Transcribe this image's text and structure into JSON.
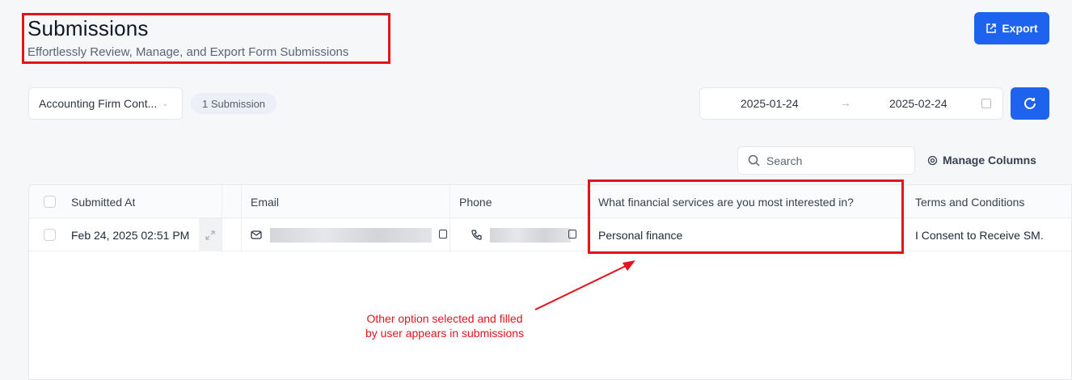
{
  "header": {
    "title": "Submissions",
    "subtitle": "Effortlessly Review, Manage, and Export Form Submissions"
  },
  "toolbar": {
    "export_label": "Export",
    "form_select_value": "Accounting Firm Cont...",
    "submission_count": "1 Submission",
    "date_start": "2025-01-24",
    "date_arrow": "→",
    "date_end": "2025-02-24",
    "search_placeholder": "Search",
    "manage_columns_label": "Manage Columns"
  },
  "table": {
    "columns": [
      "Submitted At",
      "Email",
      "Phone",
      "What financial services are you most interested in?",
      "Terms and Conditions"
    ],
    "rows": [
      {
        "submitted_at": "Feb 24, 2025 02:51 PM",
        "email": "",
        "phone": "",
        "financial_services": "Personal finance",
        "terms": "I Consent to Receive SM."
      }
    ]
  },
  "annotation": {
    "line1": "Other option selected and filled",
    "line2": "by user appears in submissions"
  },
  "colors": {
    "accent": "#1d63ee",
    "highlight": "#e2141c"
  }
}
